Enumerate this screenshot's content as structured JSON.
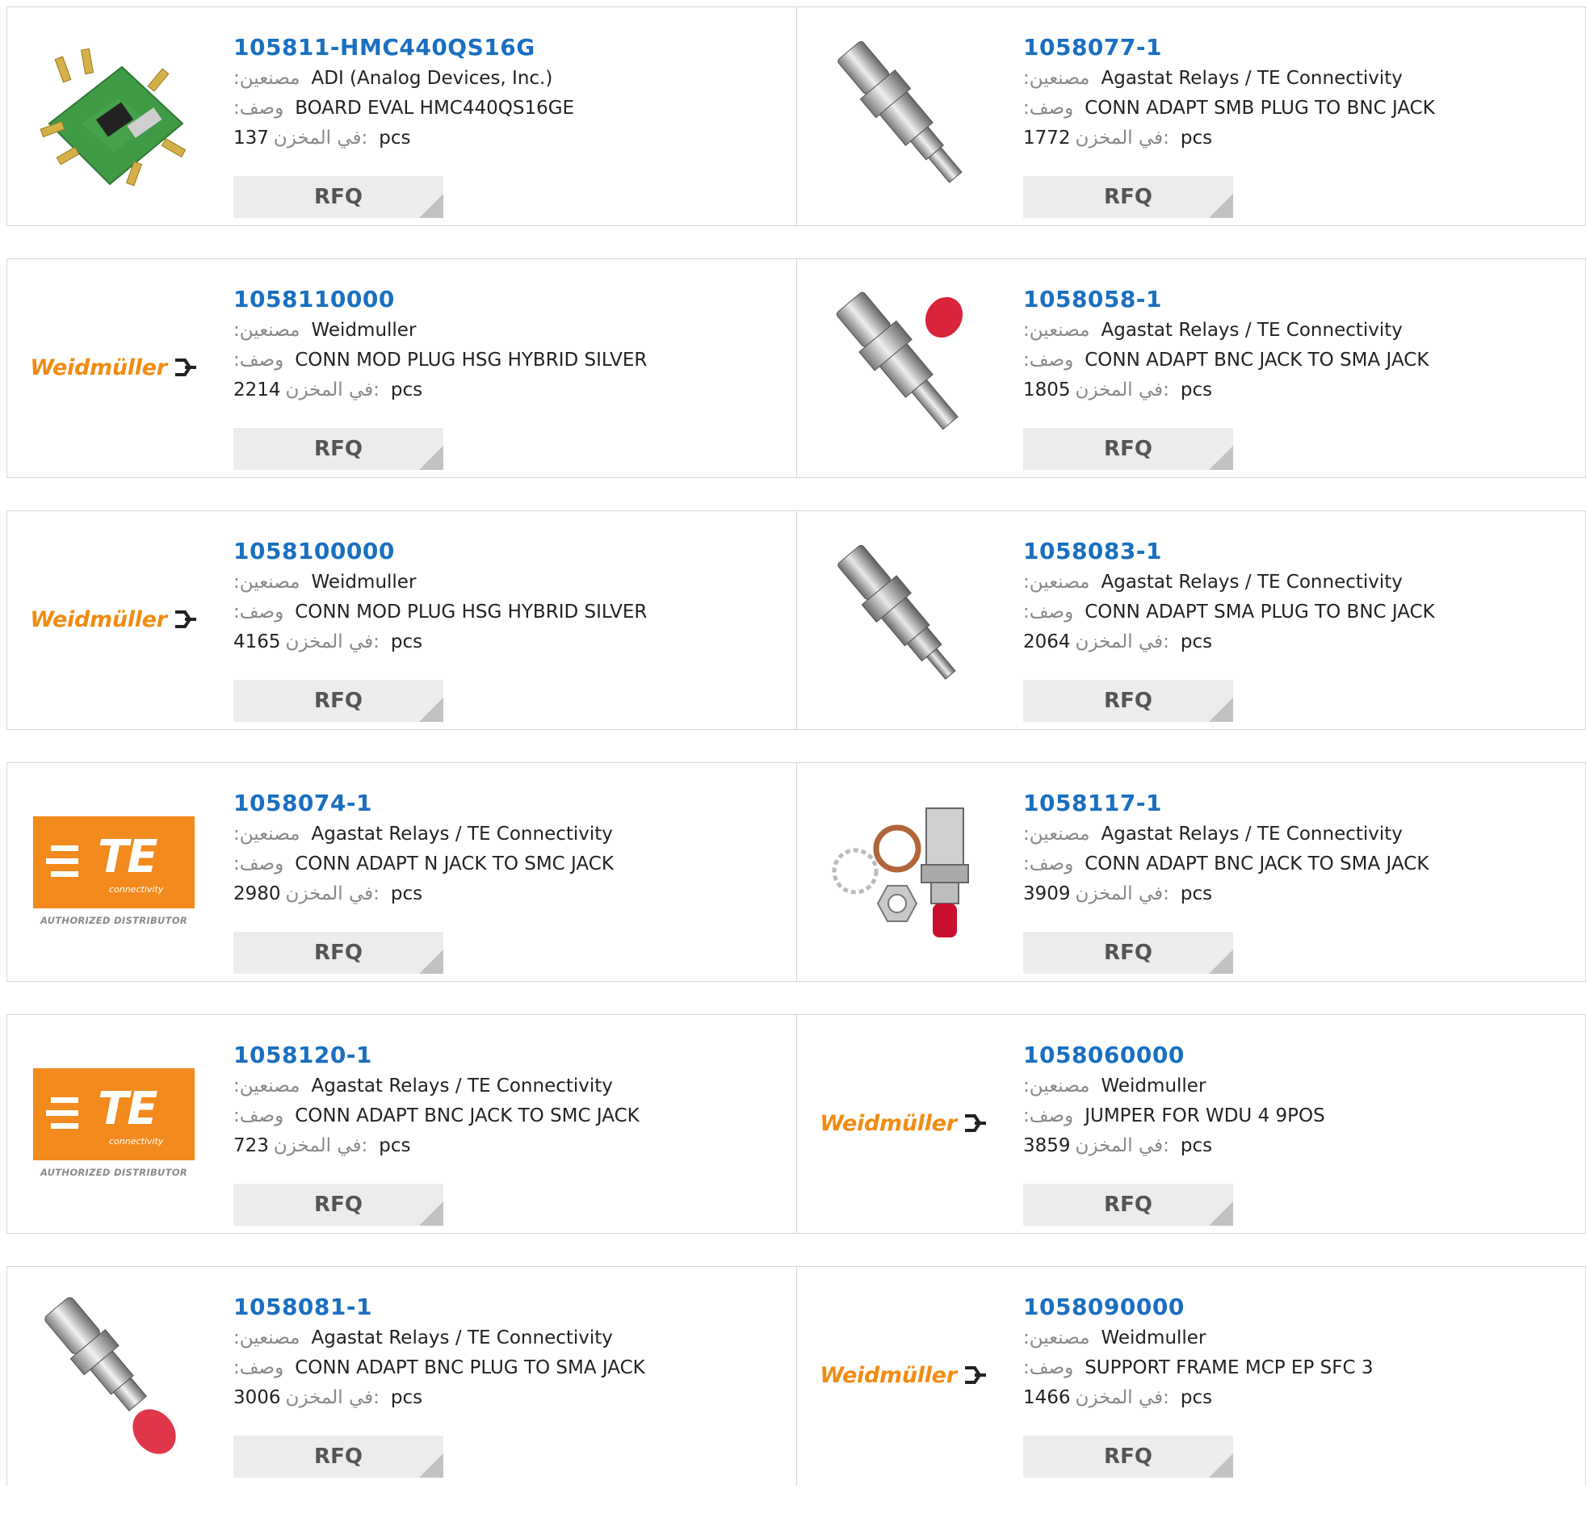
{
  "labels": {
    "manufacturer": ":مصنعين",
    "description": ":وصف",
    "stock": "في المخزن:",
    "unit": "pcs",
    "rfq": "RFQ"
  },
  "brand_colors": {
    "link": "#1a6fbf",
    "weidmuller_orange": "#f08c12",
    "te_orange": "#f28a1e"
  },
  "products": [
    {
      "part": "105811-HMC440QS16G",
      "manufacturer": "ADI (Analog Devices, Inc.)",
      "description": "BOARD EVAL HMC440QS16GE",
      "stock": "137",
      "image": "eval-board-photo"
    },
    {
      "part": "1058077-1",
      "manufacturer": "Agastat Relays / TE Connectivity",
      "description": "CONN ADAPT SMB PLUG TO BNC JACK",
      "stock": "1772",
      "image": "bnc-adapter-photo"
    },
    {
      "part": "1058110000",
      "manufacturer": "Weidmuller",
      "description": "CONN MOD PLUG HSG HYBRID SILVER",
      "stock": "2214",
      "image": "weidmuller-logo",
      "logo_text": "Weidmüller"
    },
    {
      "part": "1058058-1",
      "manufacturer": "Agastat Relays / TE Connectivity",
      "description": "CONN ADAPT BNC JACK TO SMA JACK",
      "stock": "1805",
      "image": "bnc-sma-adapter-red-cap-photo"
    },
    {
      "part": "1058100000",
      "manufacturer": "Weidmuller",
      "description": "CONN MOD PLUG HSG HYBRID SILVER",
      "stock": "4165",
      "image": "weidmuller-logo",
      "logo_text": "Weidmüller"
    },
    {
      "part": "1058083-1",
      "manufacturer": "Agastat Relays / TE Connectivity",
      "description": "CONN ADAPT SMA PLUG TO BNC JACK",
      "stock": "2064",
      "image": "sma-bnc-adapter-photo"
    },
    {
      "part": "1058074-1",
      "manufacturer": "Agastat Relays / TE Connectivity",
      "description": "CONN ADAPT N JACK TO SMC JACK",
      "stock": "2980",
      "image": "te-logo",
      "logo_text": "TE",
      "logo_sub": "connectivity",
      "logo_caption": "AUTHORIZED DISTRIBUTOR"
    },
    {
      "part": "1058117-1",
      "manufacturer": "Agastat Relays / TE Connectivity",
      "description": "CONN ADAPT BNC JACK TO SMA JACK",
      "stock": "3909",
      "image": "bulkhead-adapter-kit-photo"
    },
    {
      "part": "1058120-1",
      "manufacturer": "Agastat Relays / TE Connectivity",
      "description": "CONN ADAPT BNC JACK TO SMC JACK",
      "stock": "723",
      "image": "te-logo",
      "logo_text": "TE",
      "logo_sub": "connectivity",
      "logo_caption": "AUTHORIZED DISTRIBUTOR"
    },
    {
      "part": "1058060000",
      "manufacturer": "Weidmuller",
      "description": "JUMPER FOR WDU 4 9POS",
      "stock": "3859",
      "image": "weidmuller-logo",
      "logo_text": "Weidmüller"
    },
    {
      "part": "1058081-1",
      "manufacturer": "Agastat Relays / TE Connectivity",
      "description": "CONN ADAPT BNC PLUG TO SMA JACK",
      "stock": "3006",
      "image": "bnc-plug-sma-adapter-photo"
    },
    {
      "part": "1058090000",
      "manufacturer": "Weidmuller",
      "description": "SUPPORT FRAME MCP EP SFC 3",
      "stock": "1466",
      "image": "weidmuller-logo",
      "logo_text": "Weidmüller"
    }
  ]
}
